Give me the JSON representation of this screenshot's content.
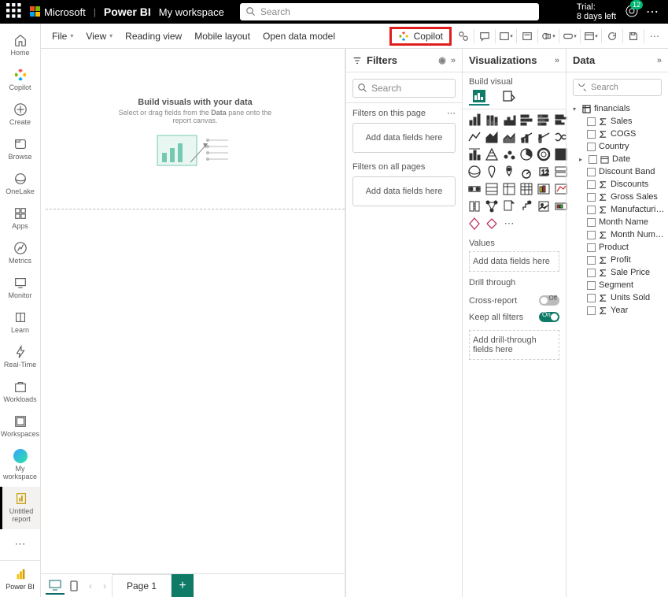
{
  "topbar": {
    "brand": "Microsoft",
    "product": "Power BI",
    "workspace": "My workspace",
    "search_placeholder": "Search",
    "trial_line1": "Trial:",
    "trial_line2": "8 days left",
    "notification_count": "12"
  },
  "leftnav": {
    "items": [
      {
        "label": "Home"
      },
      {
        "label": "Copilot"
      },
      {
        "label": "Create"
      },
      {
        "label": "Browse"
      },
      {
        "label": "OneLake"
      },
      {
        "label": "Apps"
      },
      {
        "label": "Metrics"
      },
      {
        "label": "Monitor"
      },
      {
        "label": "Learn"
      },
      {
        "label": "Real-Time"
      },
      {
        "label": "Workloads"
      },
      {
        "label": "Workspaces"
      },
      {
        "label": "My workspace"
      },
      {
        "label": "Untitled report"
      }
    ],
    "bottom": "Power BI"
  },
  "ribbon": {
    "file": "File",
    "view": "View",
    "reading": "Reading view",
    "mobile": "Mobile layout",
    "openmodel": "Open data model",
    "copilot": "Copilot"
  },
  "canvas": {
    "title": "Build visuals with your data",
    "subtitle1": "Select or drag fields from the ",
    "subtitle_bold": "Data",
    "subtitle2": " pane onto the",
    "subtitle3": "report canvas."
  },
  "pages": {
    "page1": "Page 1"
  },
  "filters": {
    "title": "Filters",
    "search": "Search",
    "thispage": "Filters on this page",
    "allpages": "Filters on all pages",
    "drop": "Add data fields here"
  },
  "viz": {
    "title": "Visualizations",
    "build": "Build visual",
    "values": "Values",
    "values_drop": "Add data fields here",
    "drill": "Drill through",
    "cross": "Cross-report",
    "keep": "Keep all filters",
    "drill_drop": "Add drill-through fields here",
    "off": "Off",
    "on": "On"
  },
  "data": {
    "title": "Data",
    "search": "Search",
    "table": "financials",
    "fields": [
      {
        "name": " Sales",
        "type": "sum"
      },
      {
        "name": "COGS",
        "type": "sum"
      },
      {
        "name": "Country",
        "type": "none"
      },
      {
        "name": "Date",
        "type": "date",
        "expandable": true
      },
      {
        "name": "Discount Band",
        "type": "none"
      },
      {
        "name": "Discounts",
        "type": "sum"
      },
      {
        "name": "Gross Sales",
        "type": "sum"
      },
      {
        "name": "Manufacturing ...",
        "type": "sum"
      },
      {
        "name": "Month Name",
        "type": "none"
      },
      {
        "name": "Month Number",
        "type": "sum"
      },
      {
        "name": "Product",
        "type": "none"
      },
      {
        "name": "Profit",
        "type": "sum"
      },
      {
        "name": "Sale Price",
        "type": "sum"
      },
      {
        "name": "Segment",
        "type": "none"
      },
      {
        "name": "Units Sold",
        "type": "sum"
      },
      {
        "name": "Year",
        "type": "sum"
      }
    ]
  }
}
